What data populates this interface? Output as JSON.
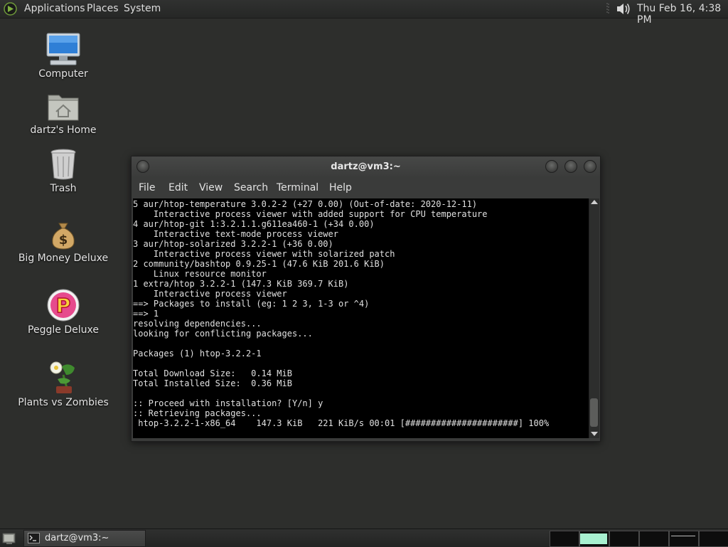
{
  "top_panel": {
    "menus": [
      "Applications",
      "Places",
      "System"
    ],
    "clock": "Thu Feb 16,  4:38 PM",
    "icons": {
      "distro": "linux-distro-logo-icon",
      "volume": "speaker-icon"
    }
  },
  "desktop": {
    "icons": [
      {
        "label": "Computer",
        "icon": "computer-monitor-icon"
      },
      {
        "label": "dartz's Home",
        "icon": "home-folder-icon"
      },
      {
        "label": "Trash",
        "icon": "trash-can-icon"
      },
      {
        "label": "Big Money Deluxe",
        "icon": "money-bag-icon"
      },
      {
        "label": "Peggle Deluxe",
        "icon": "peggle-p-icon"
      },
      {
        "label": "Plants vs Zombies",
        "icon": "plants-vs-zombies-icon"
      }
    ]
  },
  "terminal": {
    "title": "dartz@vm3:~",
    "menus": [
      "File",
      "Edit",
      "View",
      "Search",
      "Terminal",
      "Help"
    ],
    "lines": [
      "5 aur/htop-temperature 3.0.2-2 (+27 0.00) (Out-of-date: 2020-12-11)",
      "    Interactive process viewer with added support for CPU temperature",
      "4 aur/htop-git 1:3.2.1.1.g611ea460-1 (+34 0.00)",
      "    Interactive text-mode process viewer",
      "3 aur/htop-solarized 3.2.2-1 (+36 0.00)",
      "    Interactive process viewer with solarized patch",
      "2 community/bashtop 0.9.25-1 (47.6 KiB 201.6 KiB)",
      "    Linux resource monitor",
      "1 extra/htop 3.2.2-1 (147.3 KiB 369.7 KiB)",
      "    Interactive process viewer",
      "==> Packages to install (eg: 1 2 3, 1-3 or ^4)",
      "==> 1",
      "resolving dependencies...",
      "looking for conflicting packages...",
      "",
      "Packages (1) htop-3.2.2-1",
      "",
      "Total Download Size:   0.14 MiB",
      "Total Installed Size:  0.36 MiB",
      "",
      ":: Proceed with installation? [Y/n] y",
      ":: Retrieving packages...",
      " htop-3.2.2-1-x86_64    147.3 KiB   221 KiB/s 00:01 [######################] 100%"
    ]
  },
  "bottom_panel": {
    "task_label": "dartz@vm3:~",
    "workspace_count": 6,
    "active_workspace": 2,
    "colors": {
      "active_window_highlight": "#a8f0d0",
      "workspace_bg": "#0d0d0d"
    }
  }
}
